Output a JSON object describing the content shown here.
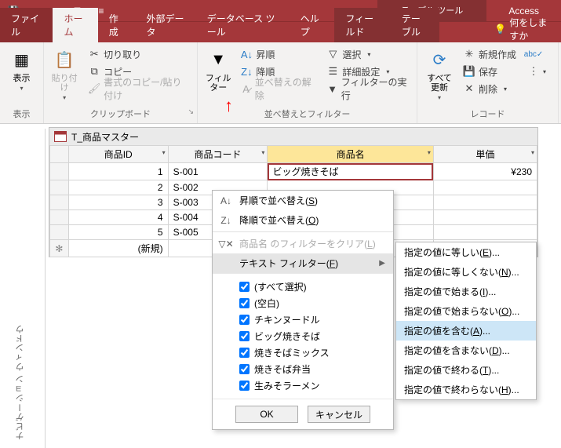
{
  "app": {
    "name": "Access",
    "context_label": "テーブル ツール"
  },
  "qat": {
    "save": "保存",
    "undo": "元に戻す",
    "redo": "やり直し"
  },
  "tabs": {
    "file": "ファイル",
    "home": "ホーム",
    "create": "作成",
    "external": "外部データ",
    "dbtools": "データベース ツール",
    "help": "ヘルプ",
    "fields": "フィールド",
    "table": "テーブル",
    "tell": "何をしますか"
  },
  "ribbon": {
    "group_view": "表示",
    "view_btn": "表示",
    "group_clipboard": "クリップボード",
    "paste": "貼り付け",
    "cut": "切り取り",
    "copy": "コピー",
    "fmtpainter": "書式のコピー/貼り付け",
    "group_sort": "並べ替えとフィルター",
    "filter_btn": "フィルター",
    "sort_asc": "昇順",
    "sort_desc": "降順",
    "sort_clear": "並べ替えの解除",
    "sel": "選択",
    "adv": "詳細設定",
    "toggle": "フィルターの実行",
    "group_records": "レコード",
    "refresh": "すべて\n更新",
    "new": "新規作成",
    "save": "保存",
    "delete": "削除"
  },
  "nav": {
    "label": "ナビゲーション ウィンドウ"
  },
  "sheet": {
    "title": "T_商品マスター",
    "columns": [
      "商品ID",
      "商品コード",
      "商品名",
      "単価"
    ],
    "rows": [
      {
        "id": 1,
        "code": "S-001",
        "name": "ビッグ焼きそば",
        "price": "¥230"
      },
      {
        "id": 2,
        "code": "S-002",
        "name": "",
        "price": ""
      },
      {
        "id": 3,
        "code": "S-003",
        "name": "",
        "price": ""
      },
      {
        "id": 4,
        "code": "S-004",
        "name": "",
        "price": ""
      },
      {
        "id": 5,
        "code": "S-005",
        "name": "",
        "price": ""
      }
    ],
    "new_row": "(新規)"
  },
  "ctx": {
    "sort_asc": "昇順で並べ替え(",
    "sort_asc_k": "S",
    "close": ")",
    "sort_desc": "降順で並べ替え(",
    "sort_desc_k": "O",
    "clear_filter_pre": "商品名 のフィルターをクリア(",
    "clear_filter_k": "L",
    "text_filter": "テキスト フィルター(",
    "text_filter_k": "F",
    "chk_all": "(すべて選択)",
    "chk_blank": "(空白)",
    "chk_items": [
      "チキンヌードル",
      "ビッグ焼きそば",
      "焼きそばミックス",
      "焼きそば弁当",
      "生みそラーメン"
    ],
    "ok": "OK",
    "cancel": "キャンセル"
  },
  "sub": {
    "items": [
      {
        "t": "指定の値に等しい(",
        "k": "E",
        "s": ")..."
      },
      {
        "t": "指定の値に等しくない(",
        "k": "N",
        "s": ")..."
      },
      {
        "t": "指定の値で始まる(",
        "k": "I",
        "s": ")..."
      },
      {
        "t": "指定の値で始まらない(",
        "k": "O",
        "s": ")..."
      },
      {
        "t": "指定の値を含む(",
        "k": "A",
        "s": ")...",
        "hover": true
      },
      {
        "t": "指定の値を含まない(",
        "k": "D",
        "s": ")..."
      },
      {
        "t": "指定の値で終わる(",
        "k": "T",
        "s": ")..."
      },
      {
        "t": "指定の値で終わらない(",
        "k": "H",
        "s": ")..."
      }
    ]
  }
}
